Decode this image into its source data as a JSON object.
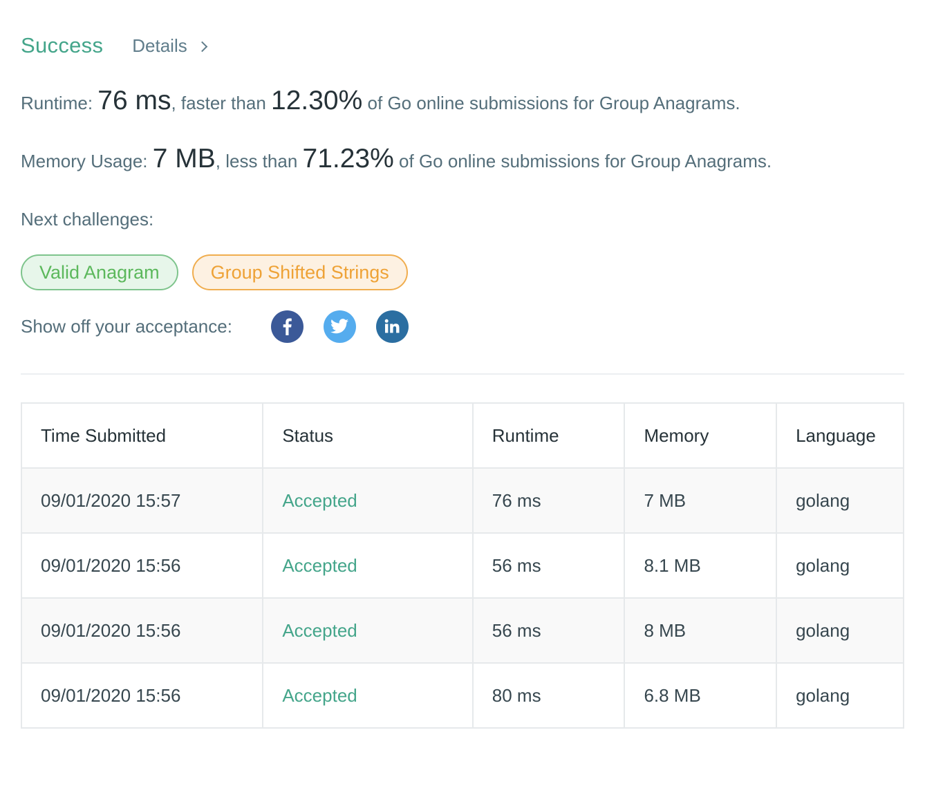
{
  "header": {
    "status": "Success",
    "details_label": "Details"
  },
  "runtime": {
    "label": "Runtime:",
    "value": "76 ms",
    "comparison": ", faster than",
    "percent": "12.30%",
    "suffix": "of Go online submissions for Group Anagrams."
  },
  "memory": {
    "label": "Memory Usage:",
    "value": "7 MB",
    "comparison": ", less than",
    "percent": "71.23%",
    "suffix": "of Go online submissions for Group Anagrams."
  },
  "next": {
    "label": "Next challenges:",
    "challenges": [
      {
        "label": "Valid Anagram",
        "difficulty": "easy"
      },
      {
        "label": "Group Shifted Strings",
        "difficulty": "medium"
      }
    ]
  },
  "share": {
    "label": "Show off your acceptance:",
    "icons": [
      "facebook-icon",
      "twitter-icon",
      "linkedin-icon"
    ],
    "colors": {
      "facebook": "#3b5998",
      "twitter": "#55acee",
      "linkedin": "#2b6ea1"
    }
  },
  "table": {
    "columns": [
      "Time Submitted",
      "Status",
      "Runtime",
      "Memory",
      "Language"
    ],
    "rows": [
      [
        "09/01/2020 15:57",
        "Accepted",
        "76 ms",
        "7 MB",
        "golang"
      ],
      [
        "09/01/2020 15:56",
        "Accepted",
        "56 ms",
        "8.1 MB",
        "golang"
      ],
      [
        "09/01/2020 15:56",
        "Accepted",
        "56 ms",
        "8 MB",
        "golang"
      ],
      [
        "09/01/2020 15:56",
        "Accepted",
        "80 ms",
        "6.8 MB",
        "golang"
      ]
    ]
  },
  "colors": {
    "success": "#44a58a",
    "easy": "#5cb85c",
    "medium": "#eea236"
  }
}
